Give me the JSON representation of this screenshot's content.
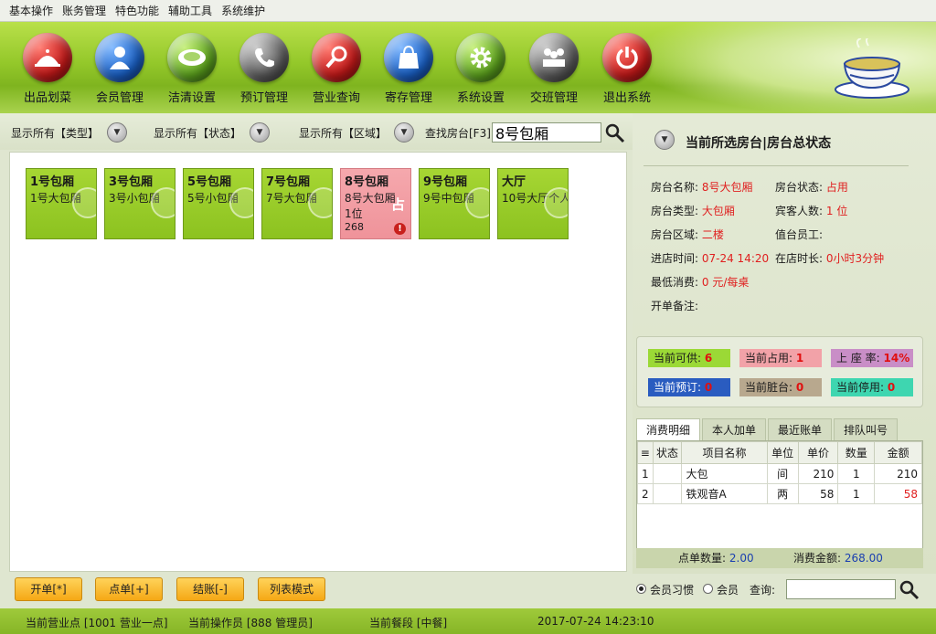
{
  "menu": [
    "基本操作",
    "账务管理",
    "特色功能",
    "辅助工具",
    "系统维护"
  ],
  "toolbar": [
    {
      "label": "出品划菜",
      "icon": "serving-dome-icon",
      "color": "#d9262b"
    },
    {
      "label": "会员管理",
      "icon": "person-icon",
      "color": "#1f6fd0"
    },
    {
      "label": "洁清设置",
      "icon": "plate-icon",
      "color": "#6eb12a"
    },
    {
      "label": "预订管理",
      "icon": "phone-icon",
      "color": "#6a6a6a"
    },
    {
      "label": "营业查询",
      "icon": "magnifier-icon",
      "color": "#d9262b"
    },
    {
      "label": "寄存管理",
      "icon": "bag-icon",
      "color": "#1f6fd0"
    },
    {
      "label": "系统设置",
      "icon": "gear-icon",
      "color": "#6eb12a"
    },
    {
      "label": "交班管理",
      "icon": "people-icon",
      "color": "#6a6a6a"
    },
    {
      "label": "退出系统",
      "icon": "power-icon",
      "color": "#d9262b"
    }
  ],
  "filters": {
    "type": "显示所有【类型】",
    "status": "显示所有【状态】",
    "area": "显示所有【区域】",
    "search_label": "查找房台[F3]",
    "search_value": "8号包厢"
  },
  "rooms": [
    {
      "name": "1号包厢",
      "type": "1号大包厢",
      "status": "free"
    },
    {
      "name": "3号包厢",
      "type": "3号小包厢",
      "status": "free"
    },
    {
      "name": "5号包厢",
      "type": "5号小包厢",
      "status": "free"
    },
    {
      "name": "7号包厢",
      "type": "7号大包厢",
      "status": "free"
    },
    {
      "name": "8号包厢",
      "type": "8号大包厢",
      "guests": "1位",
      "amount": "268",
      "badge": "占",
      "status": "occupied"
    },
    {
      "name": "9号包厢",
      "type": "9号中包厢",
      "status": "free"
    },
    {
      "name": "大厅",
      "type": "10号大厅个人",
      "status": "free"
    }
  ],
  "actions": {
    "open": "开单[*]",
    "order": "点单[+]",
    "checkout": "结账[-]",
    "list_mode": "列表模式"
  },
  "detail": {
    "title": "当前所选房台|房台总状态",
    "name_label": "房台名称:",
    "name": "8号大包厢",
    "state_label": "房台状态:",
    "state": "占用",
    "type_label": "房台类型:",
    "type": "大包厢",
    "guests_label": "宾客人数:",
    "guests": "1 位",
    "area_label": "房台区域:",
    "area": "二楼",
    "waiter_label": "值台员工:",
    "waiter": "",
    "in_label": "进店时间:",
    "in_time": "07-24 14:20",
    "dur_label": "在店时长:",
    "duration": "0小时3分钟",
    "min_label": "最低消费:",
    "min_spend": "0 元/每桌",
    "note_label": "开单备注:",
    "note": ""
  },
  "stats": {
    "available_label": "当前可供:",
    "available": "6",
    "occupied_label": "当前占用:",
    "occupied": "1",
    "rate_label": "上 座 率:",
    "rate": "14%",
    "reserved_label": "当前预订:",
    "reserved": "0",
    "dirty_label": "当前脏台:",
    "dirty": "0",
    "disabled_label": "当前停用:",
    "disabled": "0",
    "colors": {
      "available": "#9bd936",
      "occupied": "#f2a2a8",
      "rate": "#c98ec7",
      "reserved": "#2a5cc0",
      "dirty": "#b8a88e",
      "disabled": "#3ed6b0"
    }
  },
  "tabs": [
    "消费明细",
    "本人加单",
    "最近账单",
    "排队叫号"
  ],
  "orders": {
    "columns": [
      "状态",
      "项目名称",
      "单位",
      "单价",
      "数量",
      "金额"
    ],
    "rows": [
      {
        "no": "1",
        "status": "",
        "item": "大包",
        "unit": "间",
        "price": "210",
        "qty": "1",
        "amount": "210"
      },
      {
        "no": "2",
        "status": "",
        "item": "铁观音A",
        "unit": "两",
        "price": "58",
        "qty": "1",
        "amount": "58"
      }
    ],
    "count_label": "点单数量:",
    "count": "2.00",
    "total_label": "消费金额:",
    "total": "268.00"
  },
  "query": {
    "member_habit": "会员习惯",
    "member": "会员",
    "query_label": "查询:",
    "query_value": ""
  },
  "status_bar": {
    "outlet": "当前营业点 [1001 营业一点]",
    "operator": "当前操作员 [888 管理员]",
    "period": "当前餐段 [中餐]",
    "datetime": "2017-07-24 14:23:10"
  }
}
